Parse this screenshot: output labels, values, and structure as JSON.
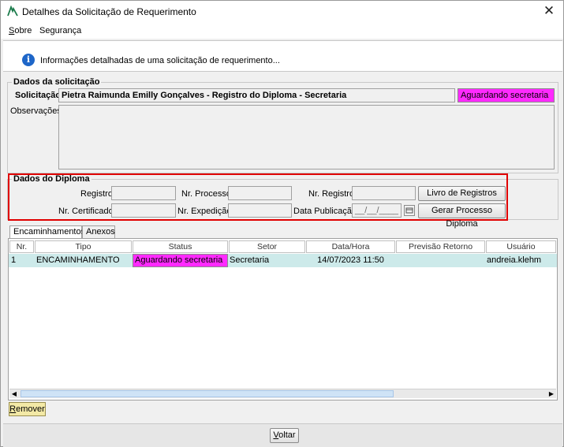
{
  "window": {
    "title": "Detalhes da Solicitação de Requerimento",
    "close_glyph": "✕"
  },
  "menu": {
    "items": [
      {
        "label": "Sobre",
        "mnemonic": "S",
        "rest": "obre"
      },
      {
        "label": "Segurança"
      }
    ]
  },
  "info": {
    "text": "Informações detalhadas de uma solicitação de requerimento..."
  },
  "dados_solicitacao": {
    "legend": "Dados da solicitação",
    "solicitacao_label": "Solicitação:",
    "solicitacao_value": "Pietra Raimunda Emilly Gonçalves - Registro do Diploma - Secretaria",
    "status": "Aguardando secretaria",
    "observacoes_label": "Observações:",
    "observacoes_value": ""
  },
  "dados_diploma": {
    "legend": "Dados do Diploma",
    "registro_label": "Registro:",
    "nr_processo_label": "Nr. Processo:",
    "nr_registro_label": "Nr. Registro:",
    "nr_certificado_label": "Nr. Certificado:",
    "nr_expedicao_label": "Nr. Expedição:",
    "data_publicacao_label": "Data Publicação:",
    "data_publicacao_placeholder": "__/__/____",
    "livro_button": "Livro de Registros",
    "gerar_button": "Gerar Processo Diploma"
  },
  "tabs": [
    {
      "label": "Encaminhamentos",
      "active": true
    },
    {
      "label": "Anexos",
      "active": false
    }
  ],
  "table": {
    "columns": [
      "Nr.",
      "Tipo",
      "Status",
      "Setor",
      "Data/Hora",
      "Previsão Retorno",
      "Usuário"
    ],
    "rows": [
      {
        "nr": "1",
        "tipo": "ENCAMINHAMENTO",
        "status": "Aguardando secretaria",
        "setor": "Secretaria",
        "data_hora": "14/07/2023 11:50",
        "previsao": "",
        "usuario": "andreia.klehm"
      }
    ]
  },
  "buttons": {
    "remover": "Remover",
    "remover_mnemonic": "R",
    "remover_rest": "emover",
    "voltar": "Voltar",
    "voltar_mnemonic": "V",
    "voltar_rest": "oltar"
  },
  "colors": {
    "status_magenta": "#ff2aff",
    "row_highlight": "#cdeaea",
    "highlight_border": "#e00000",
    "remover_bg": "#f3e9a6"
  }
}
